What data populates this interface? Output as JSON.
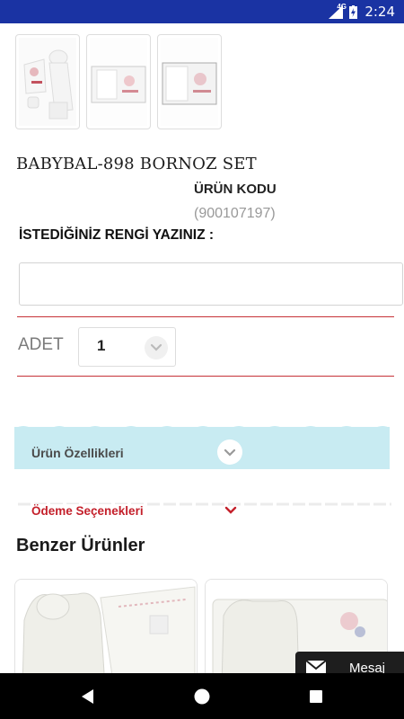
{
  "status_bar": {
    "time": "2:24",
    "network": "4G"
  },
  "gallery": {
    "thumbnails": [
      "product-image-1",
      "product-image-2",
      "product-image-3"
    ]
  },
  "product": {
    "name": "BABYBAL-898 BORNOZ SET",
    "code_label": "ÜRÜN KODU",
    "code_value": "(900107197)"
  },
  "color_field": {
    "label": "İSTEDİĞİNİZ RENGİ YAZINIZ :",
    "value": "",
    "placeholder": ""
  },
  "quantity": {
    "label": "ADET",
    "value": "1"
  },
  "features": {
    "label": "Ürün Özellikleri"
  },
  "payment": {
    "label": "Ödeme Seçenekleri"
  },
  "similar": {
    "title": "Benzer Ürünler"
  },
  "message_button": {
    "label": "Mesaj"
  },
  "colors": {
    "status_bar": "#1a33a3",
    "accent_red": "#c4202b",
    "panel_blue": "#c8ebf2"
  }
}
